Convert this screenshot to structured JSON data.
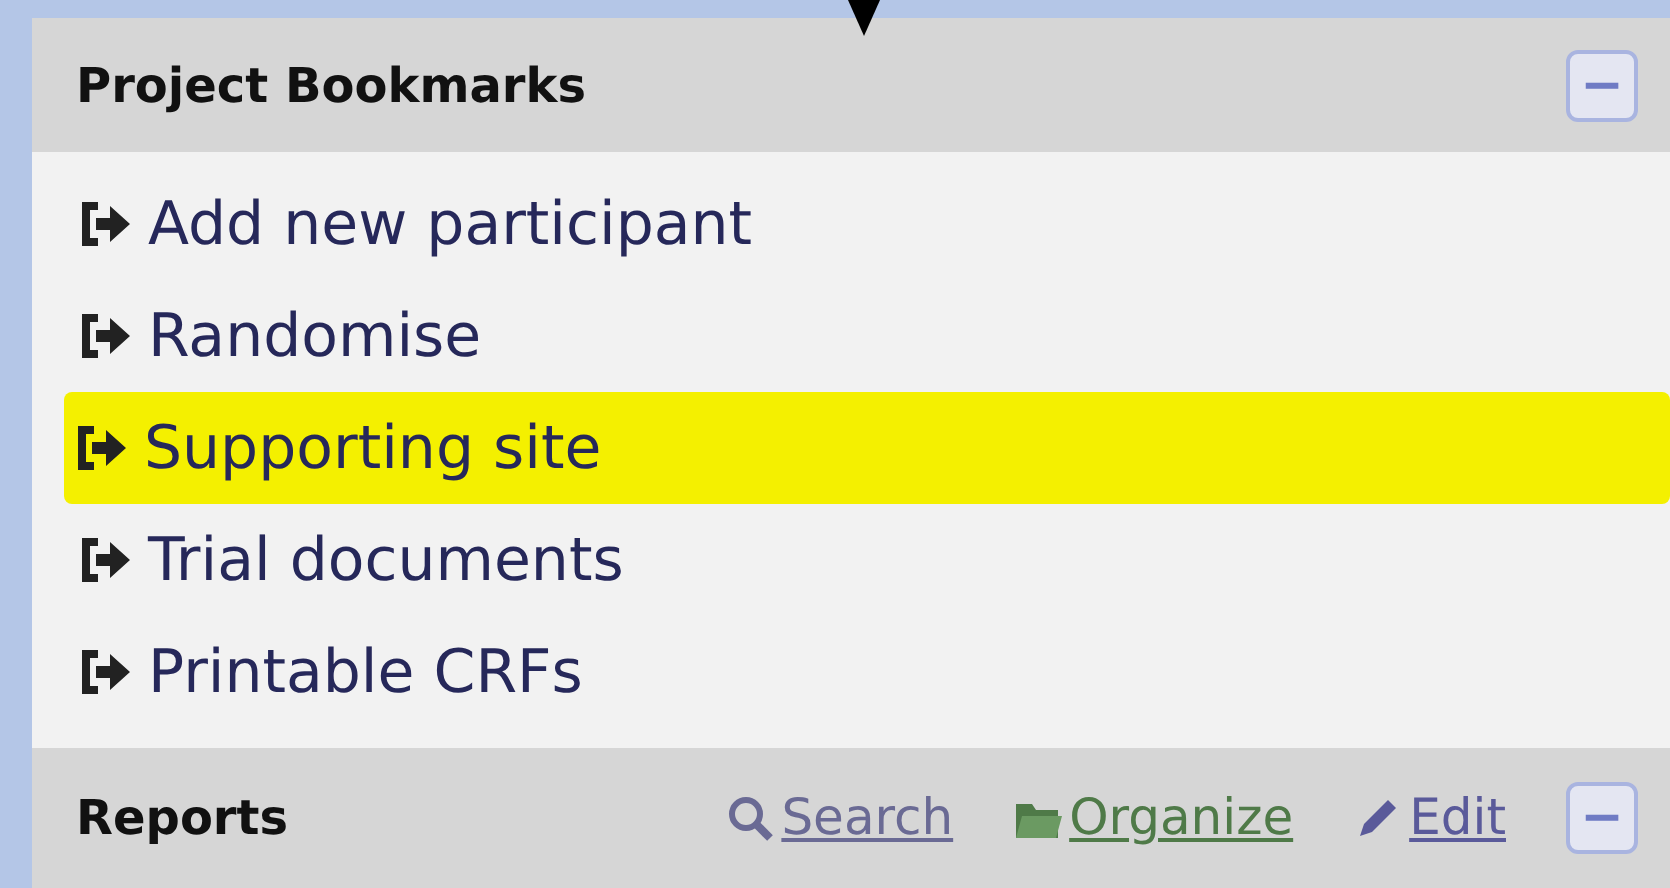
{
  "bookmarks": {
    "title": "Project Bookmarks",
    "collapse_symbol": "−",
    "items": [
      {
        "label": "Add new participant",
        "highlighted": false
      },
      {
        "label": "Randomise",
        "highlighted": false
      },
      {
        "label": "Supporting site",
        "highlighted": true
      },
      {
        "label": "Trial documents",
        "highlighted": false
      },
      {
        "label": "Printable CRFs",
        "highlighted": false
      }
    ]
  },
  "reports": {
    "title": "Reports",
    "links": [
      {
        "label": "Search",
        "kind": "search"
      },
      {
        "label": "Organize",
        "kind": "organize"
      },
      {
        "label": "Edit",
        "kind": "edit"
      }
    ],
    "collapse_symbol": "−"
  }
}
